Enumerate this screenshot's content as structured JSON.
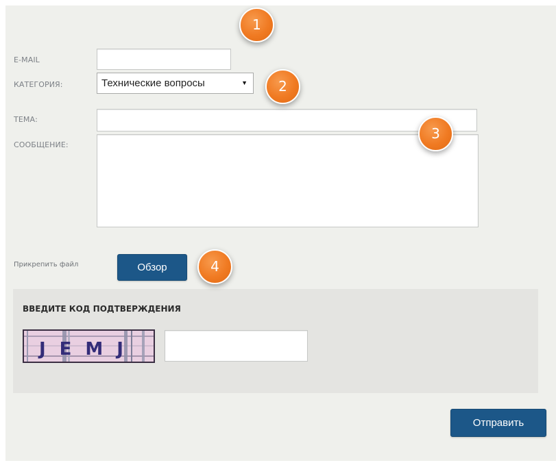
{
  "form": {
    "email_label": "E-MAIL",
    "email_value": "",
    "category_label": "КАТЕГОРИЯ:",
    "category_selected": "Технические вопросы",
    "subject_label": "ТЕМА:",
    "subject_value": "",
    "message_label": "СООБЩЕНИЕ:",
    "message_value": "",
    "attach_label": "Прикрепить файл",
    "browse_button": "Обзор"
  },
  "captcha": {
    "title": "ВВЕДИТЕ КОД ПОДТВЕРЖДЕНИЯ",
    "image_text": "JEMJ",
    "code_value": ""
  },
  "submit_button": "Отправить",
  "callouts": [
    "1",
    "2",
    "3",
    "4"
  ],
  "colors": {
    "panel_bg": "#eff0ec",
    "captcha_bg": "#e4e4e1",
    "button_bg": "#1c5788",
    "badge_orange": "#f07a22"
  },
  "icons": {
    "select_caret": "caret-down-icon"
  }
}
